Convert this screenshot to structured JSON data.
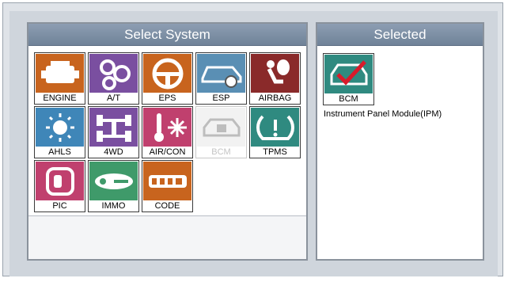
{
  "select_panel": {
    "title": "Select System",
    "tiles": [
      {
        "label": "ENGINE",
        "icon": "engine-icon",
        "color": "#c8641e",
        "enabled": true
      },
      {
        "label": "A/T",
        "icon": "gears-icon",
        "color": "#7a4fa0",
        "enabled": true
      },
      {
        "label": "EPS",
        "icon": "steering-wheel-icon",
        "color": "#c8641e",
        "enabled": true
      },
      {
        "label": "ESP",
        "icon": "car-wheel-icon",
        "color": "#5a8fb4",
        "enabled": true
      },
      {
        "label": "AIRBAG",
        "icon": "airbag-icon",
        "color": "#8a2a2a",
        "enabled": true
      },
      {
        "label": "AHLS",
        "icon": "headlamp-icon",
        "color": "#3f86b8",
        "enabled": true
      },
      {
        "label": "4WD",
        "icon": "drivetrain-icon",
        "color": "#7a4fa0",
        "enabled": true
      },
      {
        "label": "AIR/CON",
        "icon": "thermometer-snowflake-icon",
        "color": "#c0406e",
        "enabled": true
      },
      {
        "label": "BCM",
        "icon": "car-body-icon",
        "color": "#d8d8d8",
        "enabled": false
      },
      {
        "label": "TPMS",
        "icon": "tire-pressure-icon",
        "color": "#2f8a80",
        "enabled": true
      },
      {
        "label": "PIC",
        "icon": "key-fob-icon",
        "color": "#c0406e",
        "enabled": true
      },
      {
        "label": "IMMO",
        "icon": "key-icon",
        "color": "#3f9a6a",
        "enabled": true
      },
      {
        "label": "CODE",
        "icon": "key-code-icon",
        "color": "#c8641e",
        "enabled": true
      }
    ]
  },
  "selected_panel": {
    "title": "Selected",
    "tile": {
      "label": "BCM",
      "icon": "car-body-check-icon",
      "color": "#2f8a80"
    },
    "description": "Instrument Panel Module(IPM)"
  }
}
